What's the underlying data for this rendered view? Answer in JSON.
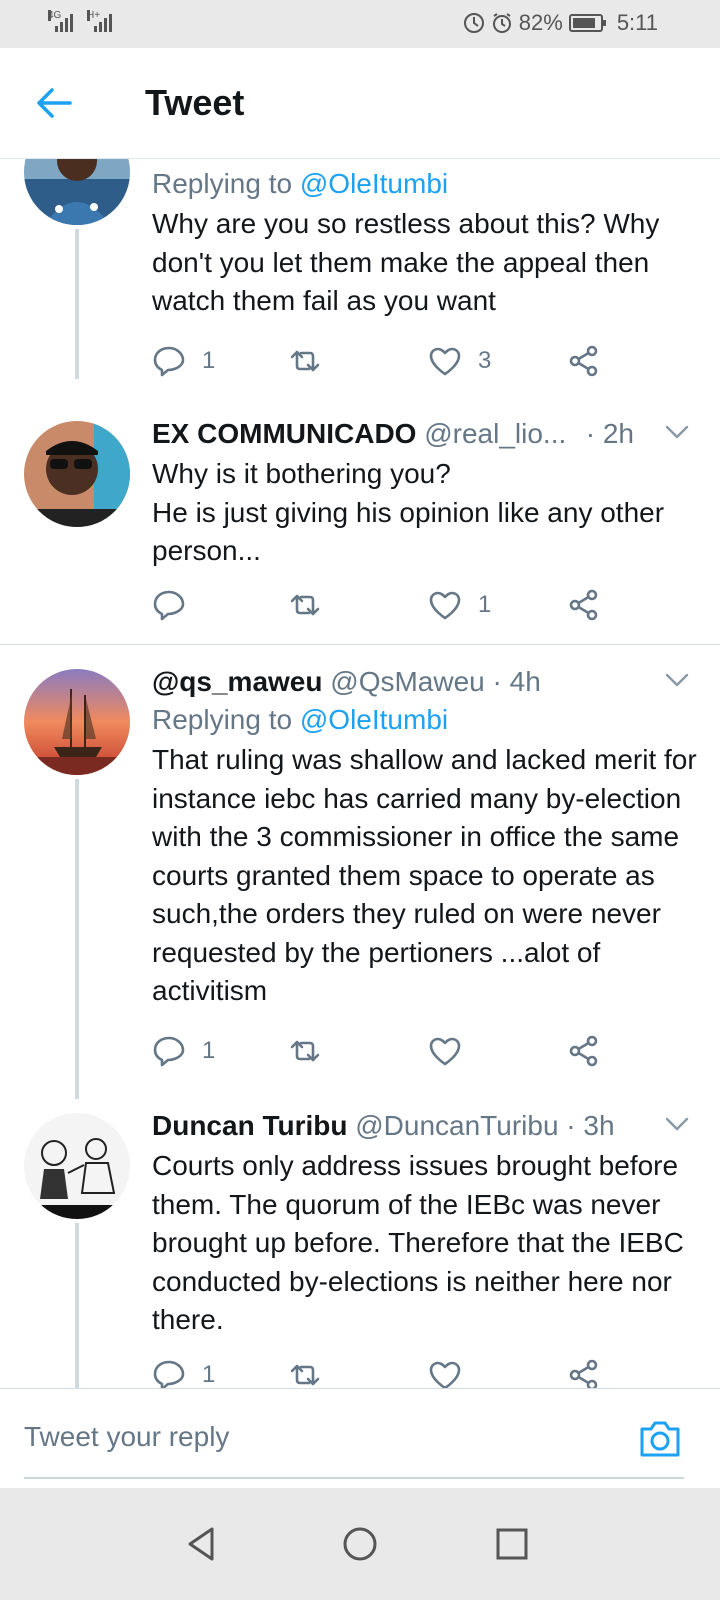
{
  "status_bar": {
    "network_1": "4G",
    "network_2": "H+",
    "battery_percent": "82%",
    "time": "5:11"
  },
  "header": {
    "title": "Tweet"
  },
  "tweets": [
    {
      "replying_prefix": "Replying to",
      "replying_to": "@OleItumbi",
      "text": "Why are you so restless about this? Why don't you let them make the appeal then watch them fail as you want",
      "replies": "1",
      "retweets": "",
      "likes": "3"
    },
    {
      "name": "EX COMMUNICADO",
      "handle": "@real_lio...",
      "time": "· 2h",
      "text": "Why is it bothering you?\nHe is just giving his opinion like any other person...",
      "replies": "",
      "retweets": "",
      "likes": "1"
    },
    {
      "name": "@qs_maweu",
      "handle": "@QsMaweu",
      "time": "· 4h",
      "replying_prefix": "Replying to",
      "replying_to": "@OleItumbi",
      "text": "That ruling was shallow and lacked merit for instance iebc has carried many by-election with the 3 commissioner in office the same courts granted them space to operate as such,the orders they ruled on were never requested by the pertioners ...alot of activitism",
      "replies": "1",
      "retweets": "",
      "likes": ""
    },
    {
      "name": "Duncan Turibu",
      "handle": "@DuncanTuribu",
      "time": "· 3h",
      "text": "Courts only address issues brought before them. The quorum of the IEBc was never brought up before. Therefore that the IEBC conducted by-elections is neither here nor there.",
      "replies": "1",
      "retweets": "",
      "likes": ""
    }
  ],
  "reply_box": {
    "placeholder": "Tweet your reply"
  },
  "colors": {
    "accent": "#1da1f2",
    "secondary_text": "#657786",
    "primary_text": "#14171a",
    "thread_line": "#cfd9de",
    "system_bar": "#e9e9e9"
  },
  "icons": {
    "back": "arrow-left-icon",
    "reply": "speech-bubble-icon",
    "retweet": "retweet-icon",
    "like": "heart-icon",
    "share": "share-icon",
    "caret": "chevron-down-icon",
    "camera": "camera-icon",
    "nav": [
      "back-triangle-icon",
      "home-circle-icon",
      "recents-square-icon"
    ]
  }
}
